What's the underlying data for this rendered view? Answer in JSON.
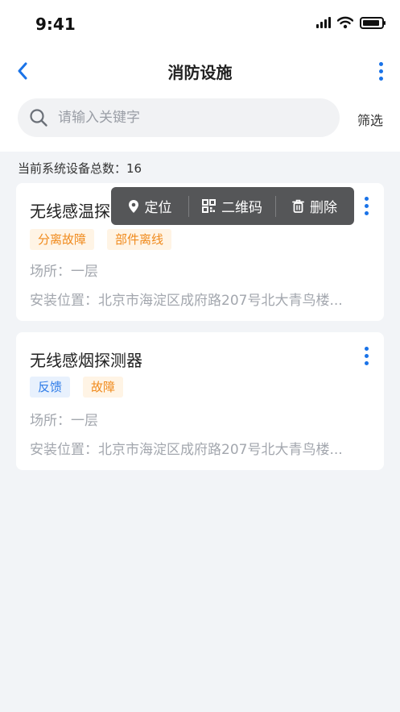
{
  "status": {
    "time": "9:41"
  },
  "nav": {
    "title": "消防设施"
  },
  "search": {
    "placeholder": "请输入关键字",
    "filter_label": "筛选"
  },
  "summary": {
    "count_label": "当前系统设备总数：16"
  },
  "devices": [
    {
      "title": "无线感温探测器",
      "tags": [
        {
          "label": "分离故障",
          "color": "#f08a1c"
        },
        {
          "label": "部件离线",
          "color": "#f08a1c"
        }
      ],
      "place": "场所：一层",
      "location": "安装位置：北京市海淀区成府路207号北大青鸟楼..."
    },
    {
      "title": "无线感烟探测器",
      "tags": [
        {
          "label": "反馈",
          "color": "#2f7ce8"
        },
        {
          "label": "故障",
          "color": "#f08a1c"
        }
      ],
      "place": "场所：一层",
      "location": "安装位置：北京市海淀区成府路207号北大青鸟楼..."
    }
  ],
  "context_menu": {
    "items": [
      {
        "label": "定位",
        "icon": "location-pin-icon"
      },
      {
        "label": "二维码",
        "icon": "qr-code-icon"
      },
      {
        "label": "删除",
        "icon": "trash-icon"
      }
    ]
  },
  "colors": {
    "accent": "#1a73e8",
    "background": "#f2f4f7",
    "popup": "#555658"
  }
}
